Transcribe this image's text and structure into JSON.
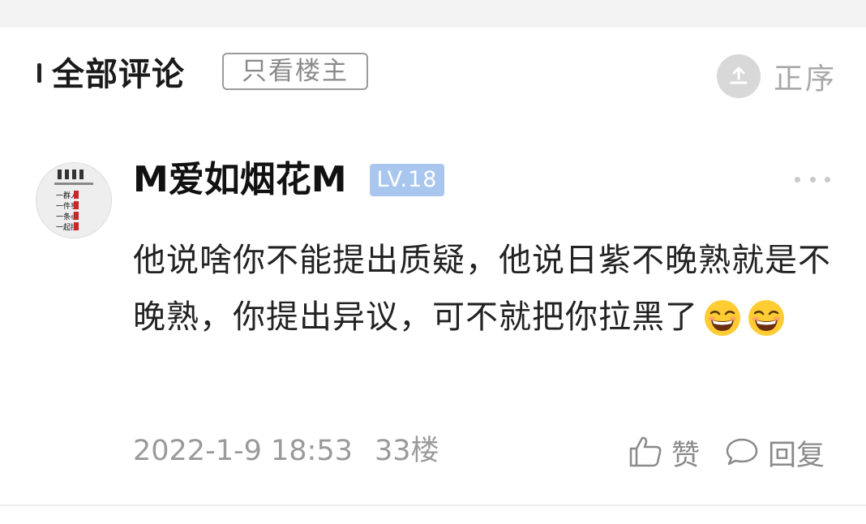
{
  "header": {
    "title": "全部评论",
    "filter_label": "只看楼主",
    "sort_label": "正序",
    "sort_icon": "sort-ascending-icon"
  },
  "comment": {
    "username": "M爱如烟花M",
    "level": "LV.18",
    "text": "他说啥你不能提出质疑，他说日紫不晚熟就是不晚熟，你提出异议，可不就把你拉黑了",
    "emojis": [
      "grinning-squint-emoji",
      "grinning-squint-emoji"
    ],
    "date": "2022-1-9 18:53",
    "floor": "33楼",
    "like_label": "赞",
    "reply_label": "回复",
    "avatar_texts": [
      "一群人",
      "一件事",
      "一条心",
      "一起拼"
    ]
  },
  "colors": {
    "level_badge": "#a9c6ef",
    "secondary_text": "#9a9a9a"
  }
}
